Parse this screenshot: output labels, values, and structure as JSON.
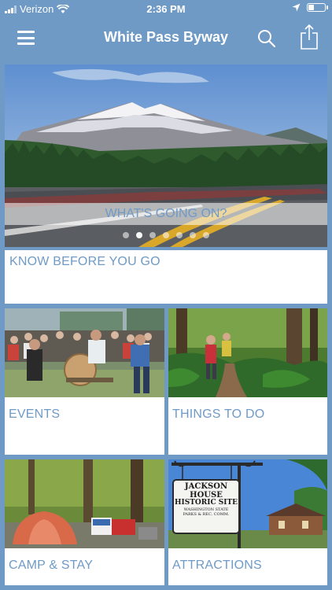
{
  "status_bar": {
    "carrier": "Verizon",
    "time": "2:36 PM",
    "battery_level": 0.35
  },
  "nav": {
    "title": "White Pass Byway",
    "menu_icon": "hamburger-icon",
    "search_icon": "search-icon",
    "share_icon": "share-icon"
  },
  "hero": {
    "banner_label": "WHAT'S GOING ON?",
    "slide_count": 7,
    "active_slide": 1
  },
  "tiles": {
    "know_before": "KNOW BEFORE YOU GO",
    "events": "EVENTS",
    "things_to_do": "THINGS TO DO",
    "camp_stay": "CAMP & STAY",
    "attractions": "ATTRACTIONS"
  },
  "sign": {
    "line1": "JACKSON",
    "line2": "HOUSE",
    "line3": "HISTORIC SITE",
    "line4": "WASHINGTON STATE",
    "line5": "PARKS & REC. COMM."
  },
  "colors": {
    "background": "#6f9ac6",
    "label": "#6f9ac6"
  }
}
